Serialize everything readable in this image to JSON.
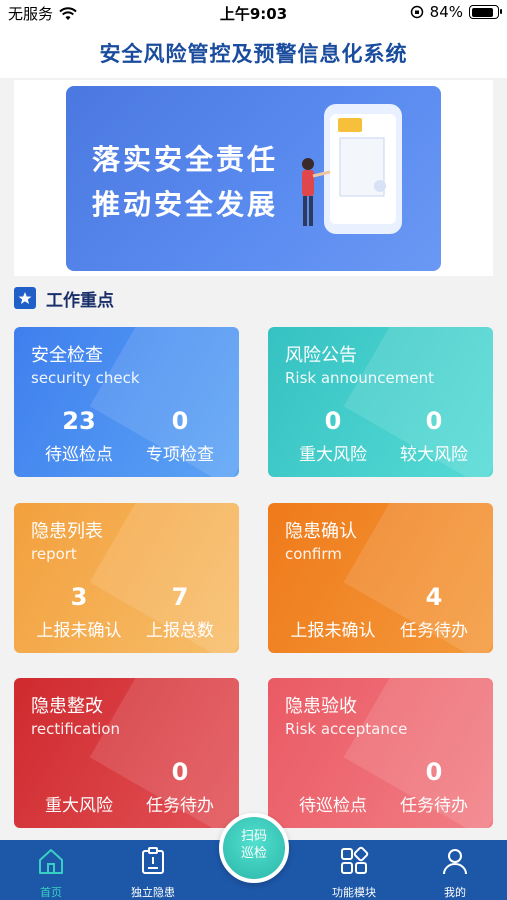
{
  "status_bar": {
    "carrier": "无服务",
    "time": "上午9:03",
    "battery": "84%",
    "battery_level": 0.84
  },
  "header": {
    "title": "安全风险管控及预警信息化系统"
  },
  "banner": {
    "line1": "落实安全责任",
    "line2": "推动安全发展"
  },
  "section": {
    "title": "工作重点"
  },
  "cards": [
    {
      "title": "安全检查",
      "subtitle": "security check",
      "stats": [
        {
          "value": "23",
          "label": "待巡检点"
        },
        {
          "value": "0",
          "label": "专项检查"
        }
      ]
    },
    {
      "title": "风险公告",
      "subtitle": "Risk announcement",
      "stats": [
        {
          "value": "0",
          "label": "重大风险"
        },
        {
          "value": "0",
          "label": "较大风险"
        }
      ]
    },
    {
      "title": "隐患列表",
      "subtitle": "report",
      "stats": [
        {
          "value": "3",
          "label": "上报未确认"
        },
        {
          "value": "7",
          "label": "上报总数"
        }
      ]
    },
    {
      "title": "隐患确认",
      "subtitle": "confirm",
      "stats": [
        {
          "value": "",
          "label": "上报未确认"
        },
        {
          "value": "4",
          "label": "任务待办"
        }
      ]
    },
    {
      "title": "隐患整改",
      "subtitle": "rectification",
      "stats": [
        {
          "value": "",
          "label": "重大风险"
        },
        {
          "value": "0",
          "label": "任务待办"
        }
      ]
    },
    {
      "title": "隐患验收",
      "subtitle": "Risk acceptance",
      "stats": [
        {
          "value": "",
          "label": "待巡检点"
        },
        {
          "value": "0",
          "label": "任务待办"
        }
      ]
    }
  ],
  "tabbar": {
    "items": [
      {
        "label": "首页",
        "icon": "home-icon",
        "active": true
      },
      {
        "label": "独立隐患",
        "icon": "report-icon",
        "active": false
      },
      {
        "label": "功能模块",
        "icon": "modules-icon",
        "active": false
      },
      {
        "label": "我的",
        "icon": "user-icon",
        "active": false
      }
    ],
    "scan": {
      "line1": "扫码",
      "line2": "巡检"
    }
  },
  "colors": {
    "tab_bar": "#1d57a8",
    "active_tab": "#38d0c3",
    "title": "#1a4c9e"
  }
}
